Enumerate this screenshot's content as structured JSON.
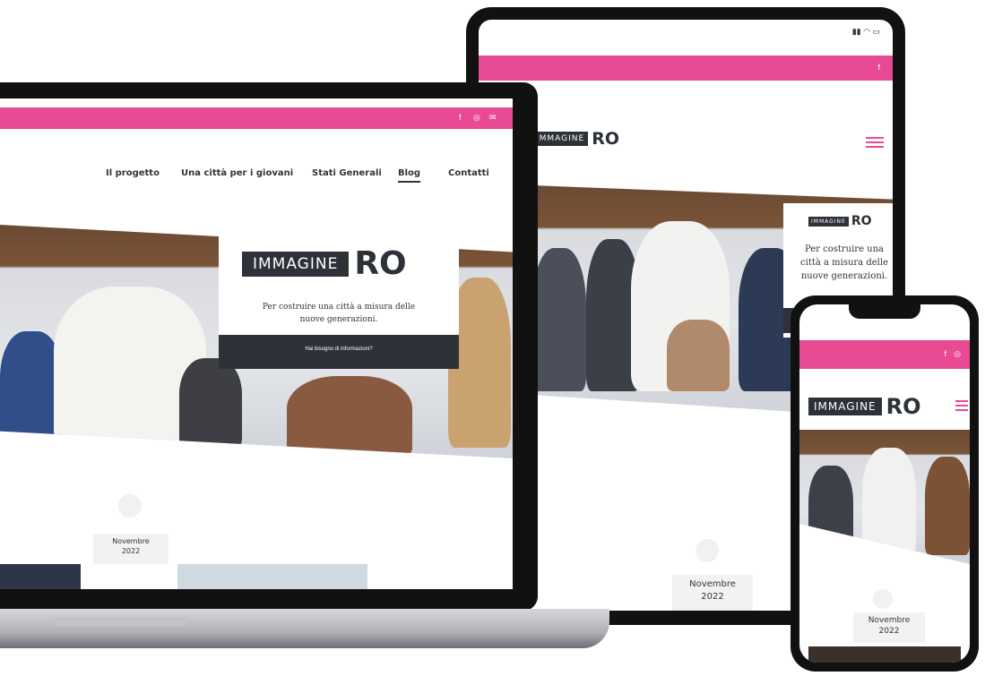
{
  "brand": {
    "logo_word": "IMMAGINE",
    "logo_suffix": "RO"
  },
  "laptop": {
    "nav": [
      "Il progetto",
      "Una città per i giovani",
      "Stati Generali",
      "Blog",
      "Contatti"
    ],
    "active_nav": "Blog",
    "hero_tagline": "Per costruire una città a misura delle nuove generazioni.",
    "hero_cta": "Hai bisogno di informazioni?",
    "date_month": "Novembre",
    "date_year": "2022",
    "social_icons": [
      "facebook-icon",
      "instagram-icon",
      "mail-icon"
    ]
  },
  "tablet": {
    "status_bar": "signal-wifi-battery",
    "hero_tagline": "Per costruire una città a misura delle nuove generazioni.",
    "date_month": "Novembre",
    "date_year": "2022"
  },
  "phone": {
    "date_month": "Novembre",
    "date_year": "2022"
  },
  "colors": {
    "accent_pink": "#e84a93",
    "logo_dark": "#2d3138"
  }
}
